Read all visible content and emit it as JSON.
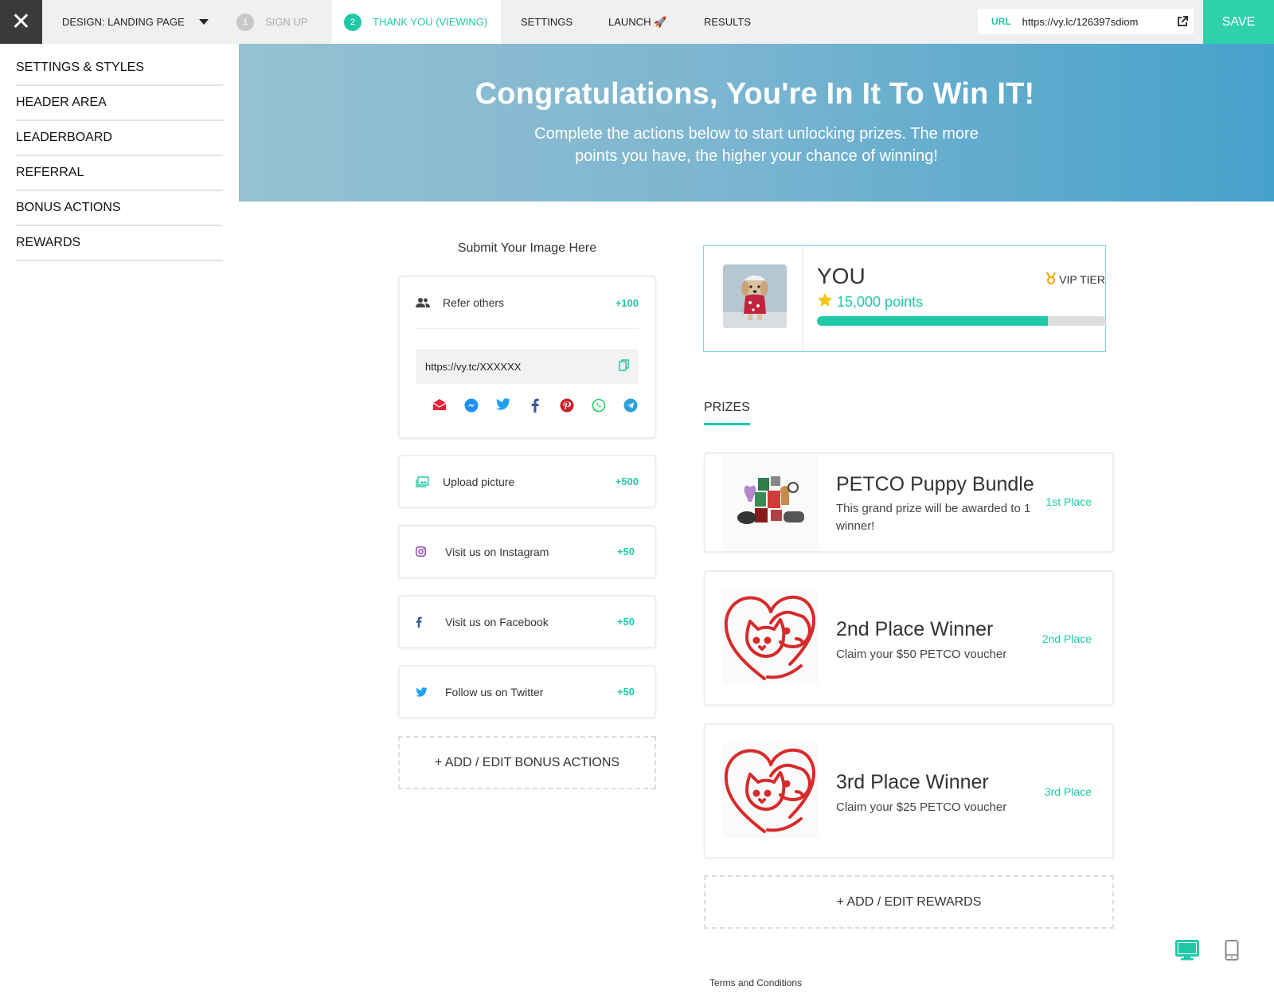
{
  "topbar": {
    "close_label": "✕",
    "design_dropdown": "DESIGN: LANDING PAGE",
    "steps": [
      {
        "num": "1",
        "label": "SIGN UP"
      },
      {
        "num": "2",
        "label": "THANK YOU (VIEWING)"
      }
    ],
    "nav": {
      "settings": "SETTINGS",
      "launch": "LAUNCH 🚀",
      "results": "RESULTS"
    },
    "url_label": "URL",
    "url_value": "https://vy.lc/126397sdiom",
    "save_label": "SAVE"
  },
  "sidebar": {
    "items": [
      "SETTINGS & STYLES",
      "HEADER AREA",
      "LEADERBOARD",
      "REFERRAL",
      "BONUS ACTIONS",
      "REWARDS"
    ]
  },
  "hero": {
    "title": "Congratulations, You're In It To Win IT!",
    "subtitle": "Complete the actions below to start unlocking prizes. The more points you have, the higher your chance of winning!"
  },
  "actions": {
    "submit_title": "Submit Your Image Here",
    "refer": {
      "label": "Refer others",
      "points": "+100",
      "url": "https://vy.tc/XXXXXX"
    },
    "share_icons": [
      "email-icon",
      "messenger-icon",
      "twitter-icon",
      "facebook-icon",
      "pinterest-icon",
      "whatsapp-icon",
      "telegram-icon"
    ],
    "items": [
      {
        "label": "Upload picture",
        "points": "+500",
        "icon": "image-icon"
      },
      {
        "label": "Visit us on Instagram",
        "points": "+50",
        "icon": "instagram-icon"
      },
      {
        "label": "Visit us on Facebook",
        "points": "+50",
        "icon": "facebook-icon"
      },
      {
        "label": "Follow us on Twitter",
        "points": "+50",
        "icon": "twitter-icon"
      }
    ],
    "add_bonus_label": "+ ADD / EDIT BONUS ACTIONS"
  },
  "you": {
    "name": "YOU",
    "points": "15,000 points",
    "tier": "VIP TIER",
    "progress_fraction": 0.8
  },
  "prizes": {
    "tab_label": "PRIZES",
    "items": [
      {
        "title": "PETCO Puppy Bundle",
        "desc": "This grand prize will be awarded to 1 winner!",
        "place": "1st Place"
      },
      {
        "title": "2nd Place Winner",
        "desc": "Claim your $50 PETCO voucher",
        "place": "2nd Place"
      },
      {
        "title": "3rd Place Winner",
        "desc": "Claim your $25 PETCO voucher",
        "place": "3rd Place"
      }
    ],
    "add_rewards_label": "+ ADD / EDIT REWARDS"
  },
  "footer": {
    "terms": "Terms and Conditions"
  },
  "colors": {
    "accent": "#20c9a6",
    "save": "#2fd1ad",
    "heart": "#d62b2b"
  }
}
